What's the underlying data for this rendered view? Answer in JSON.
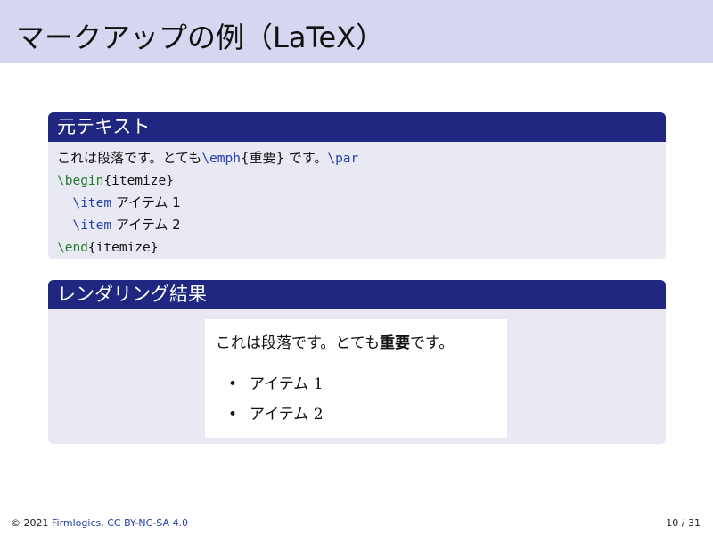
{
  "slide": {
    "title": "マークアップの例（LaTeX）"
  },
  "source_block": {
    "heading": "元テキスト",
    "line1": {
      "text_a": "これは段落です。とても",
      "cmd_emph": "\\emph",
      "arg_emph": "{重要}",
      "text_b": " です。",
      "cmd_par": "\\par"
    },
    "line2": {
      "cmd": "\\begin",
      "arg": "{itemize}"
    },
    "line3": {
      "indent": "  ",
      "cmd": "\\item",
      "text": " アイテム 1"
    },
    "line4": {
      "indent": "  ",
      "cmd": "\\item",
      "text": " アイテム 2"
    },
    "line5": {
      "cmd": "\\end",
      "arg": "{itemize}"
    }
  },
  "render_block": {
    "heading": "レンダリング結果",
    "paragraph": {
      "before": "これは段落です。とても",
      "bold": "重要",
      "after": "です。"
    },
    "items": [
      {
        "bullet": "•",
        "text": "アイテム 1"
      },
      {
        "bullet": "•",
        "text": "アイテム 2"
      }
    ]
  },
  "footer": {
    "copyright": "© 2021 ",
    "author_link": "Firmlogics, CC BY-NC-SA 4.0",
    "page": "10 / 31"
  },
  "colors": {
    "title_bg": "#d6d6f0",
    "block_head_bg": "#1f2780",
    "block_body_bg": "#e9e9f3",
    "latex_command": "#2540a8",
    "latex_environment": "#1e7d28"
  }
}
